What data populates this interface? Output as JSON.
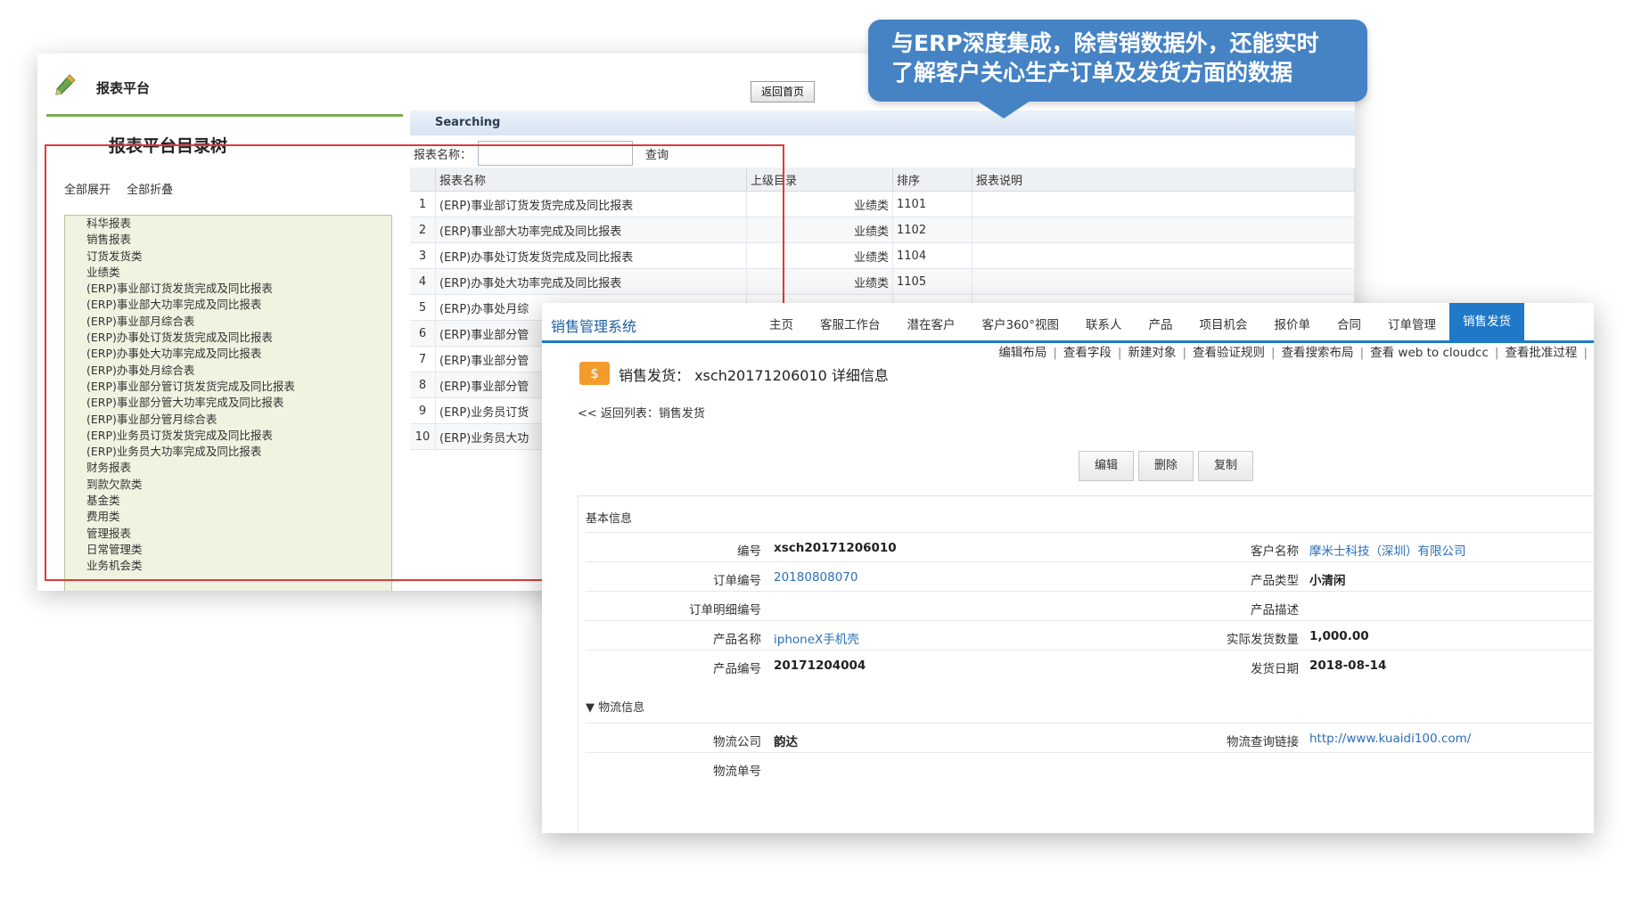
{
  "report_window": {
    "title": "报表平台",
    "home_button": "返回首页",
    "tree_title": "报表平台目录树",
    "expand_all": "全部展开",
    "collapse_all": "全部折叠",
    "tree_items": [
      "科华报表",
      "销售报表",
      "订货发货类",
      "业绩类",
      "(ERP)事业部订货发货完成及同比报表",
      "(ERP)事业部大功率完成及同比报表",
      "(ERP)事业部月综合表",
      "(ERP)办事处订货发货完成及同比报表",
      "(ERP)办事处大功率完成及同比报表",
      "(ERP)办事处月综合表",
      "(ERP)事业部分管订货发货完成及同比报表",
      "(ERP)事业部分管大功率完成及同比报表",
      "(ERP)事业部分管月综合表",
      "(ERP)业务员订货发货完成及同比报表",
      "(ERP)业务员大功率完成及同比报表",
      "财务报表",
      "到款欠款类",
      "基金类",
      "费用类",
      "管理报表",
      "日常管理类",
      "业务机会类"
    ],
    "search_bar": "Searching",
    "search_label": "报表名称：",
    "search_value": "",
    "search_button": "查询",
    "columns": [
      "报表名称",
      "上级目录",
      "排序",
      "报表说明"
    ],
    "rows": [
      {
        "no": "1",
        "name": "(ERP)事业部订货发货完成及同比报表",
        "parent": "业绩类",
        "sort": "1101",
        "desc": ""
      },
      {
        "no": "2",
        "name": "(ERP)事业部大功率完成及同比报表",
        "parent": "业绩类",
        "sort": "1102",
        "desc": ""
      },
      {
        "no": "3",
        "name": "(ERP)办事处订货发货完成及同比报表",
        "parent": "业绩类",
        "sort": "1104",
        "desc": ""
      },
      {
        "no": "4",
        "name": "(ERP)办事处大功率完成及同比报表",
        "parent": "业绩类",
        "sort": "1105",
        "desc": ""
      },
      {
        "no": "5",
        "name": "(ERP)办事处月综",
        "parent": "",
        "sort": "",
        "desc": ""
      },
      {
        "no": "6",
        "name": "(ERP)事业部分管",
        "parent": "",
        "sort": "",
        "desc": ""
      },
      {
        "no": "7",
        "name": "(ERP)事业部分管",
        "parent": "",
        "sort": "",
        "desc": ""
      },
      {
        "no": "8",
        "name": "(ERP)事业部分管",
        "parent": "",
        "sort": "",
        "desc": ""
      },
      {
        "no": "9",
        "name": "(ERP)业务员订货",
        "parent": "",
        "sort": "",
        "desc": ""
      },
      {
        "no": "10",
        "name": "(ERP)业务员大功",
        "parent": "",
        "sort": "",
        "desc": ""
      }
    ]
  },
  "callout": {
    "line1": "与ERP深度集成，除营销数据外，还能实时",
    "line2": "了解客户关心生产订单及发货方面的数据"
  },
  "sales_window": {
    "brand": "销售管理系统",
    "tabs": [
      "主页",
      "客服工作台",
      "潜在客户",
      "客户360°视图",
      "联系人",
      "产品",
      "项目机会",
      "报价单",
      "合同",
      "订单管理",
      "销售发货"
    ],
    "active_tab": "销售发货",
    "links": [
      "编辑布局",
      "查看字段",
      "新建对象",
      "查看验证规则",
      "查看搜索布局",
      "查看 web to cloudcc",
      "查看批准过程"
    ],
    "icon_glyph": "$",
    "heading": "销售发货： xsch20171206010 详细信息",
    "back_link": "<< 返回列表：销售发货",
    "buttons": [
      "编辑",
      "删除",
      "复制"
    ],
    "section_basic": "基本信息",
    "section_logistics": "▼ 物流信息",
    "fields": {
      "code_label": "编号",
      "code_value": "xsch20171206010",
      "customer_label": "客户名称",
      "customer_value": "摩米士科技（深圳）有限公司",
      "order_no_label": "订单编号",
      "order_no_value": "20180808070",
      "product_type_label": "产品类型",
      "product_type_value": "小清闲",
      "order_detail_label": "订单明细编号",
      "order_detail_value": "",
      "product_desc_label": "产品描述",
      "product_desc_value": "",
      "product_name_label": "产品名称",
      "product_name_value": "iphoneX手机壳",
      "ship_qty_label": "实际发货数量",
      "ship_qty_value": "1,000.00",
      "product_code_label": "产品编号",
      "product_code_value": "20171204004",
      "ship_date_label": "发货日期",
      "ship_date_value": "2018-08-14",
      "carrier_label": "物流公司",
      "carrier_value": "韵达",
      "tracking_link_label": "物流查询链接",
      "tracking_link_value": "http://www.kuaidi100.com/",
      "tracking_no_label": "物流单号",
      "tracking_no_value": ""
    }
  },
  "colors": {
    "callout": "#4583c5",
    "nav_active": "#1f78c8",
    "highlight_box": "#e0393b",
    "tree_bg": "#eff3e0",
    "link": "#2a6fb8"
  }
}
